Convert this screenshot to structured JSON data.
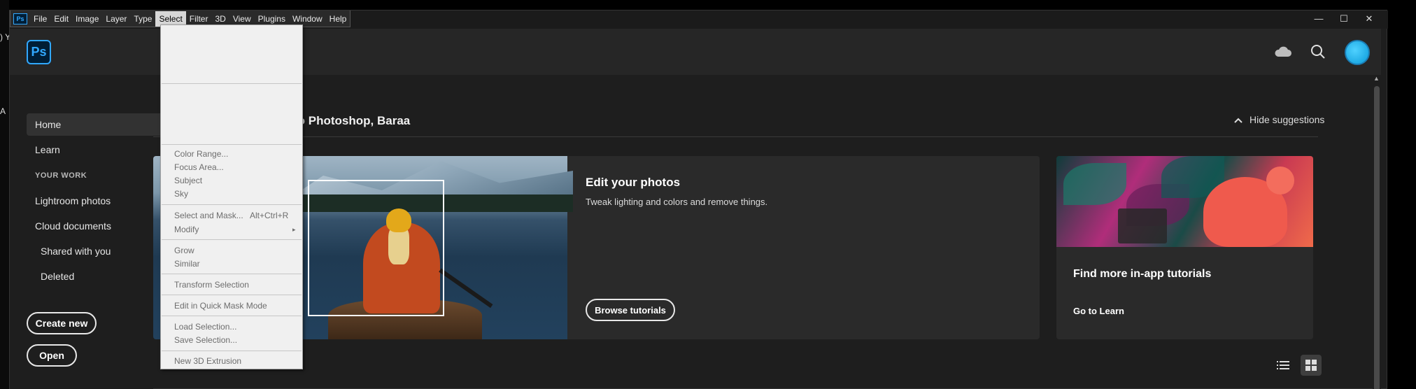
{
  "menubar": {
    "items": [
      "File",
      "Edit",
      "Image",
      "Layer",
      "Type",
      "Select",
      "Filter",
      "3D",
      "View",
      "Plugins",
      "Window",
      "Help"
    ],
    "active": "Select"
  },
  "desktop_fragments": [
    ") Y",
    "A"
  ],
  "window_controls": [
    "—",
    "☐",
    "✕"
  ],
  "app": {
    "logo": "Ps"
  },
  "sidebar": {
    "home": "Home",
    "learn": "Learn",
    "your_work": "YOUR WORK",
    "lightroom": "Lightroom photos",
    "cloud_docs": "Cloud documents",
    "shared": "Shared with you",
    "deleted": "Deleted",
    "create_new": "Create new",
    "open": "Open"
  },
  "main": {
    "welcome": "to Photoshop, Baraa",
    "hide_suggestions": "Hide suggestions",
    "card1": {
      "title": "Edit your photos",
      "desc": "Tweak lighting and colors and remove things.",
      "button": "Browse tutorials"
    },
    "card2": {
      "title": "Find more in-app tutorials",
      "link": "Go to Learn"
    }
  },
  "select_menu": {
    "items": [
      {
        "label": "Color Range..."
      },
      {
        "label": "Focus Area..."
      },
      {
        "label": "Subject"
      },
      {
        "label": "Sky"
      },
      {
        "label": "Select and Mask...",
        "shortcut": "Alt+Ctrl+R"
      },
      {
        "label": "Modify",
        "submenu": "▸"
      },
      {
        "label": "Grow"
      },
      {
        "label": "Similar"
      },
      {
        "label": "Transform Selection"
      },
      {
        "label": "Edit in Quick Mask Mode"
      },
      {
        "label": "Load Selection..."
      },
      {
        "label": "Save Selection..."
      },
      {
        "label": "New 3D Extrusion"
      }
    ]
  },
  "colors": {
    "accent": "#31a8ff",
    "background": "#1e1e1e",
    "menu_bg": "#f0f0f0"
  },
  "icons": {
    "cloud": "cloud-icon",
    "search": "search-icon",
    "chevron_up": "chevron-up-icon",
    "list_view": "list-view-icon",
    "grid_view": "grid-view-icon"
  }
}
